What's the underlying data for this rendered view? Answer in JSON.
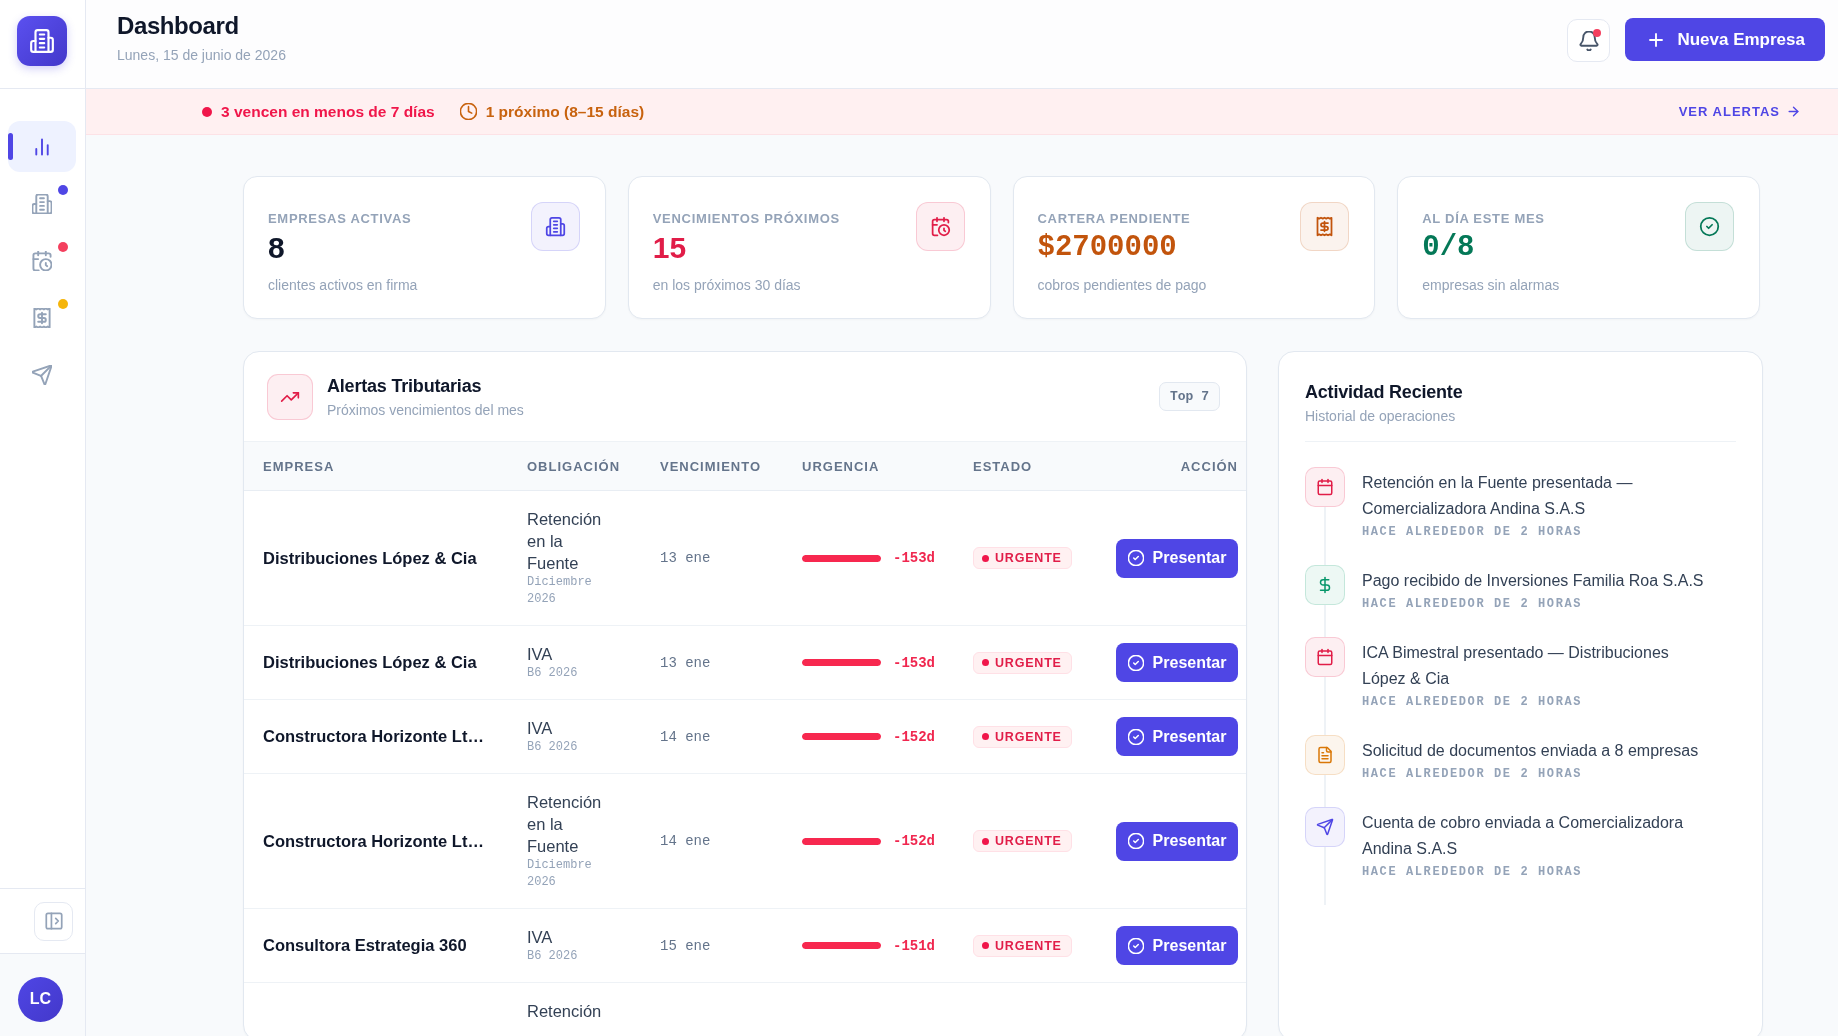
{
  "sidebar": {
    "items": [
      {
        "selected": true
      },
      {
        "selected": false,
        "color": "#4f46e5"
      },
      {
        "selected": false,
        "color": "#f43f5e"
      },
      {
        "selected": false,
        "color": "#f5b50b"
      },
      {
        "selected": false
      }
    ],
    "avatar": "LC"
  },
  "header": {
    "title": "Dashboard",
    "date": "Lunes, 15 de junio de 2026",
    "unread": true,
    "action": "Nueva Empresa"
  },
  "banner": {
    "items": [
      {
        "kind": "urgent",
        "color": "#f0164a",
        "text": "3 vencen en menos de 7 días"
      },
      {
        "kind": "upcoming",
        "color": "#c8620e",
        "text": "1 próximo (8–15 días)"
      }
    ],
    "link": "VER ALERTAS"
  },
  "stats": [
    {
      "label": "EMPRESAS ACTIVAS",
      "value": "8",
      "caption": "clientes activos en firma",
      "kind": "total",
      "color": "#4f46e5"
    },
    {
      "label": "VENCIMIENTOS PRÓXIMOS",
      "value": "15",
      "caption": "en los próximos 30 días",
      "kind": "alert",
      "color": "#e11d48"
    },
    {
      "label": "CARTERA PENDIENTE",
      "value": "$2700000",
      "caption": "cobros pendientes de pago",
      "kind": "money",
      "color": "#c2540c"
    },
    {
      "label": "AL DÍA ESTE MES",
      "value": "0/8",
      "caption": "empresas sin alarmas",
      "kind": "ratio",
      "color": "#047857"
    }
  ],
  "alerts": {
    "title": "Alertas Tributarias",
    "subtitle": "Próximos vencimientos del mes",
    "badge": "Top 7",
    "columns": [
      "EMPRESA",
      "OBLIGACIÓN",
      "VENCIMIENTO",
      "URGENCIA",
      "ESTADO",
      "ACCIÓN"
    ],
    "rows": [
      {
        "company": "Distribuciones López & Cia",
        "obligation": "Retención en la Fuente",
        "period": "Diciembre 2026",
        "due": "13 ene",
        "urgency": {
          "level": 1,
          "reading": "-153d"
        },
        "status": "URGENTE",
        "action": "Presentar"
      },
      {
        "company": "Distribuciones López & Cia",
        "obligation": "IVA",
        "period": "B6 2026",
        "due": "13 ene",
        "urgency": {
          "level": 1,
          "reading": "-153d"
        },
        "status": "URGENTE",
        "action": "Presentar"
      },
      {
        "company": "Constructora Horizonte Lt…",
        "obligation": "IVA",
        "period": "B6 2026",
        "due": "14 ene",
        "urgency": {
          "level": 1,
          "reading": "-152d"
        },
        "status": "URGENTE",
        "action": "Presentar"
      },
      {
        "company": "Constructora Horizonte Lt…",
        "obligation": "Retención en la Fuente",
        "period": "Diciembre 2026",
        "due": "14 ene",
        "urgency": {
          "level": 1,
          "reading": "-152d"
        },
        "status": "URGENTE",
        "action": "Presentar"
      },
      {
        "company": "Consultora Estrategia 360",
        "obligation": "IVA",
        "period": "B6 2026",
        "due": "15 ene",
        "urgency": {
          "level": 1,
          "reading": "-151d"
        },
        "status": "URGENTE",
        "action": "Presentar"
      },
      {
        "obligation": "Retención"
      }
    ]
  },
  "activity": {
    "title": "Actividad Reciente",
    "subtitle": "Historial de operaciones",
    "items": [
      {
        "kind": "filing",
        "color": "#e11d48",
        "text": "Retención en la Fuente presentada — Comercializadora Andina S.A.S",
        "time": "HACE ALREDEDOR DE 2 HORAS"
      },
      {
        "kind": "payment",
        "color": "#059669",
        "text": "Pago recibido de Inversiones Familia Roa S.A.S",
        "time": "HACE ALREDEDOR DE 2 HORAS"
      },
      {
        "kind": "filing",
        "color": "#e11d48",
        "text": "ICA Bimestral presentado — Distribuciones López & Cia",
        "time": "HACE ALREDEDOR DE 2 HORAS"
      },
      {
        "kind": "request",
        "color": "#d97706",
        "text": "Solicitud de documentos enviada a 8 empresas",
        "time": "HACE ALREDEDOR DE 2 HORAS"
      },
      {
        "kind": "invoice",
        "color": "#4f46e5",
        "text": "Cuenta de cobro enviada a Comercializadora Andina S.A.S",
        "time": "HACE ALREDEDOR DE 2 HORAS"
      }
    ]
  }
}
